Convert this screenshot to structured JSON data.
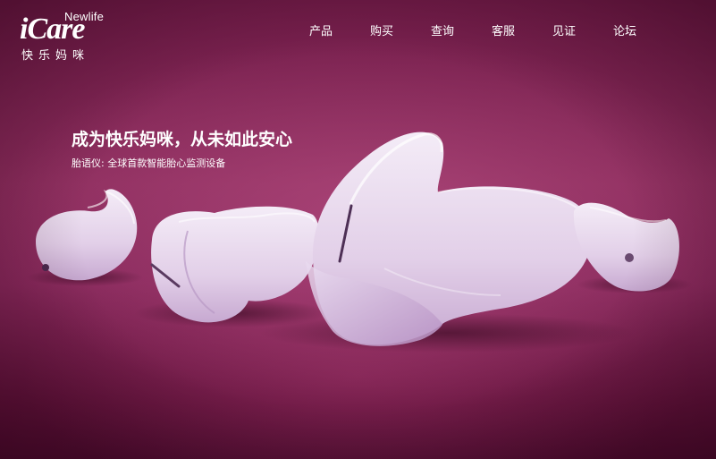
{
  "logo": {
    "newlife": "Newlife",
    "icare": "iCare",
    "tagline": "快乐妈咪"
  },
  "nav": {
    "items": [
      {
        "label": "产品"
      },
      {
        "label": "购买"
      },
      {
        "label": "查询"
      },
      {
        "label": "客服"
      },
      {
        "label": "见证"
      },
      {
        "label": "论坛"
      }
    ]
  },
  "hero": {
    "title": "成为快乐妈咪，从未如此安心",
    "subtitle": "胎语仪: 全球首款智能胎心监测设备"
  },
  "colors": {
    "background": "#86285a",
    "text": "#ffffff",
    "product": "#ecdff2"
  }
}
